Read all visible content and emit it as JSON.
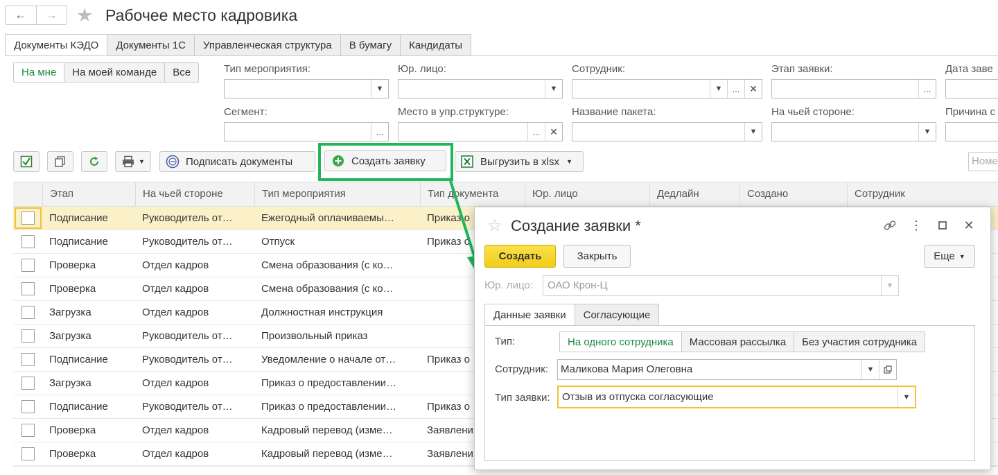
{
  "window": {
    "title": "Рабочее место кадровика",
    "back_arrow": "←",
    "forward_arrow": "→",
    "star": "★"
  },
  "tabs": [
    "Документы КЭДО",
    "Документы 1С",
    "Управленческая структура",
    "В бумагу",
    "Кандидаты"
  ],
  "scope_filter": [
    "На мне",
    "На моей команде",
    "Все"
  ],
  "filters": {
    "event_type_label": "Тип мероприятия:",
    "legal_entity_label": "Юр. лицо:",
    "employee_label": "Сотрудник:",
    "stage_label": "Этап заявки:",
    "request_date_label": "Дата заве",
    "segment_label": "Сегмент:",
    "org_place_label": "Место в упр.структуре:",
    "package_name_label": "Название пакета:",
    "on_whose_side_label": "На чьей стороне:",
    "reason_label": "Причина с"
  },
  "toolbar": {
    "sign_documents": "Подписать документы",
    "create_request": "Создать заявку",
    "export_xlsx": "Выгрузить в xlsx",
    "search_placeholder": "Номе"
  },
  "table": {
    "columns": [
      "Этап",
      "На чьей стороне",
      "Тип мероприятия",
      "Тип документа",
      "Юр. лицо",
      "Дедлайн",
      "Создано",
      "Сотрудник"
    ],
    "rows": [
      [
        "Подписание",
        "Руководитель от…",
        "Ежегодный оплачиваемы…",
        "Приказ о"
      ],
      [
        "Подписание",
        "Руководитель от…",
        "Отпуск",
        "Приказ о"
      ],
      [
        "Проверка",
        "Отдел кадров",
        "Смена образования (с ко…",
        ""
      ],
      [
        "Проверка",
        "Отдел кадров",
        "Смена образования (с ко…",
        ""
      ],
      [
        "Загрузка",
        "Отдел кадров",
        "Должностная инструкция",
        ""
      ],
      [
        "Загрузка",
        "Руководитель от…",
        "Произвольный приказ",
        ""
      ],
      [
        "Подписание",
        "Руководитель от…",
        "Уведомление о начале от…",
        "Приказ о"
      ],
      [
        "Загрузка",
        "Отдел кадров",
        "Приказ о предоставлении…",
        ""
      ],
      [
        "Подписание",
        "Руководитель от…",
        "Приказ о предоставлении…",
        "Приказ о"
      ],
      [
        "Проверка",
        "Отдел кадров",
        "Кадровый перевод (изме…",
        "Заявлени"
      ],
      [
        "Проверка",
        "Отдел кадров",
        "Кадровый перевод (изме…",
        "Заявлени"
      ]
    ]
  },
  "dialog": {
    "title": "Создание заявки *",
    "create_button": "Создать",
    "close_button": "Закрыть",
    "more_button": "Еще",
    "legal_entity_label": "Юр. лицо:",
    "legal_entity_value": "ОАО Крон-Ц",
    "tabs": [
      "Данные заявки",
      "Согласующие"
    ],
    "type_label": "Тип:",
    "type_options": [
      "На одного сотрудника",
      "Массовая рассылка",
      "Без участия сотрудника"
    ],
    "employee_label": "Сотрудник:",
    "employee_value": "Маликова Мария Олеговна",
    "request_type_label": "Тип заявки:",
    "request_type_value": "Отзыв из отпуска согласующие"
  },
  "colors": {
    "accent_green": "#1fb75a",
    "active_text_green": "#1b8a3e",
    "yellow_button": "#f5d320",
    "selection_row": "#fbf1c9"
  }
}
